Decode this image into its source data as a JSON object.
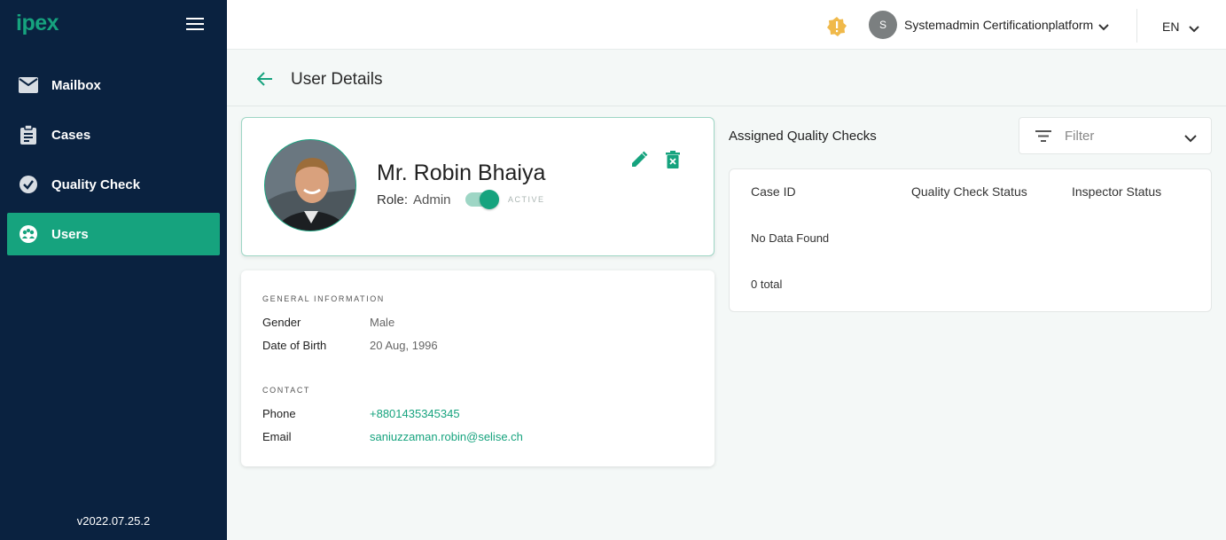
{
  "app": {
    "logo": "ipex",
    "version": "v2022.07.25.2"
  },
  "sidebar": {
    "items": [
      {
        "label": "Mailbox",
        "icon": "mail-icon"
      },
      {
        "label": "Cases",
        "icon": "clipboard-icon"
      },
      {
        "label": "Quality Check",
        "icon": "check-circle-icon"
      },
      {
        "label": "Users",
        "icon": "users-icon",
        "active": true
      }
    ]
  },
  "topbar": {
    "user_initial": "S",
    "user_name": "Systemadmin Certificationplatform",
    "language": "EN"
  },
  "page": {
    "title": "User Details"
  },
  "profile": {
    "name": "Mr. Robin Bhaiya",
    "role_label": "Role:",
    "role": "Admin",
    "status": "ACTIVE",
    "active": true
  },
  "info": {
    "general_title": "GENERAL INFORMATION",
    "gender_label": "Gender",
    "gender": "Male",
    "dob_label": "Date of Birth",
    "dob": "20 Aug, 1996",
    "contact_title": "CONTACT",
    "phone_label": "Phone",
    "phone": "+8801435345345",
    "email_label": "Email",
    "email": "saniuzzaman.robin@selise.ch"
  },
  "quality_checks": {
    "title": "Assigned Quality Checks",
    "filter_placeholder": "Filter",
    "columns": [
      "Case ID",
      "Quality Check Status",
      "Inspector Status"
    ],
    "empty_text": "No Data Found",
    "total_text": "0 total"
  },
  "colors": {
    "accent": "#16a37e",
    "sidebar_bg": "#0a2240",
    "warning": "#f0b94a"
  }
}
